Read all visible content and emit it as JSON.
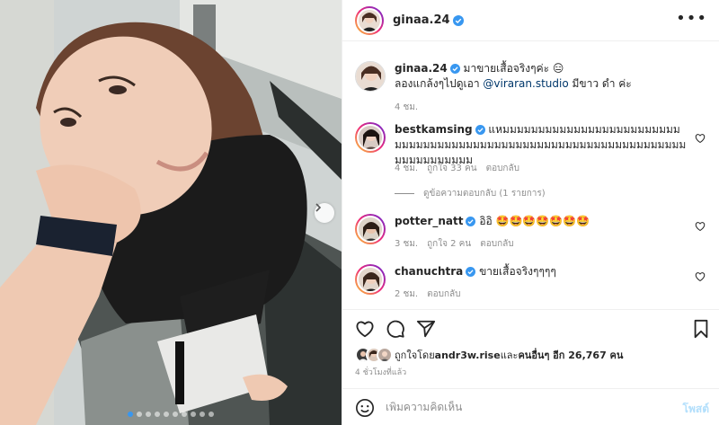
{
  "post": {
    "username": "ginaa.24",
    "more_label": "•••"
  },
  "caption": {
    "username": "ginaa.24",
    "line1": "มาขายเสื้อจริงๆค่ะ 😑",
    "line2_prefix": "ลองแกล้งๆไปดูเอา ",
    "mention": "@viraran.studio",
    "line2_suffix": " มีขาว ดำ ค่ะ",
    "time": "4 ชม."
  },
  "comments": [
    {
      "username": "bestkamsing",
      "text": "แหมมมมมมมมมมมมมมมมมมมมมมมมมมมมมมมมมมมมมมมมมมมมมมมมมมมมมมมมมมมมมมมมมมมมมมมมมมมมม",
      "time": "4 ชม.",
      "likes": "ถูกใจ 33 คน",
      "reply": "ตอบกลับ"
    },
    {
      "username": "potter_natt",
      "text": "อิอิ 🤩🤩🤩🤩🤩🤩🤩",
      "time": "3 ชม.",
      "likes": "ถูกใจ 2 คน",
      "reply": "ตอบกลับ"
    },
    {
      "username": "chanuchtra",
      "text": "ขายเสื้อจริงๆๆๆๆ",
      "time": "2 ชม.",
      "reply": "ตอบกลับ"
    }
  ],
  "view_replies": "ดูข้อความตอบกลับ (1 รายการ)",
  "likes_summary": {
    "prefix": "ถูกใจโดย ",
    "user": "andr3w.rise",
    "middle": " และ",
    "others": "คนอื่นๆ อีก 26,767 คน"
  },
  "posted_time": "4 ชั่วโมงที่แล้ว",
  "add_comment": {
    "placeholder": "เพิ่มความคิดเห็น",
    "post_label": "โพสต์"
  },
  "carousel": {
    "total": 10,
    "active": 1
  },
  "colors": {
    "verified": "#3897f0",
    "mention": "#00376b",
    "post_disabled": "#b2dffc"
  }
}
